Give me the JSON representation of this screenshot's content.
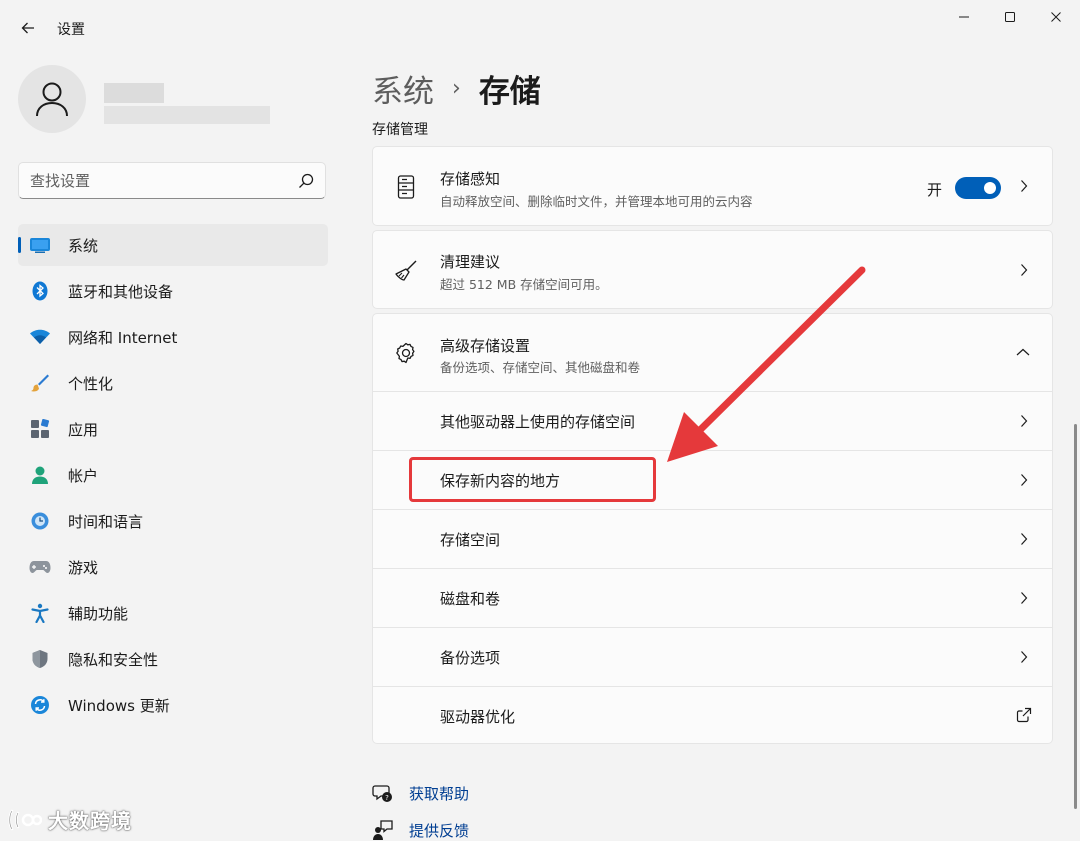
{
  "app": {
    "title": "设置"
  },
  "window_controls": {
    "minimize": "—",
    "maximize": "☐",
    "close": "✕"
  },
  "search": {
    "placeholder": "查找设置"
  },
  "nav": {
    "items": [
      {
        "label": "系统",
        "icon": "system-icon",
        "active": true
      },
      {
        "label": "蓝牙和其他设备",
        "icon": "bluetooth-icon"
      },
      {
        "label": "网络和 Internet",
        "icon": "wifi-icon"
      },
      {
        "label": "个性化",
        "icon": "brush-icon"
      },
      {
        "label": "应用",
        "icon": "apps-icon"
      },
      {
        "label": "帐户",
        "icon": "account-icon"
      },
      {
        "label": "时间和语言",
        "icon": "time-language-icon"
      },
      {
        "label": "游戏",
        "icon": "gamepad-icon"
      },
      {
        "label": "辅助功能",
        "icon": "accessibility-icon"
      },
      {
        "label": "隐私和安全性",
        "icon": "shield-icon"
      },
      {
        "label": "Windows 更新",
        "icon": "windows-update-icon"
      }
    ]
  },
  "header": {
    "parent": "系统",
    "separator": "›",
    "current": "存储"
  },
  "section": {
    "heading": "存储管理"
  },
  "cards": {
    "storage_sense": {
      "title": "存储感知",
      "desc": "自动释放空间、删除临时文件，并管理本地可用的云内容",
      "toggle_label": "开",
      "toggle_on": true
    },
    "cleanup": {
      "title": "清理建议",
      "desc": "超过 512 MB 存储空间可用。"
    },
    "advanced": {
      "title": "高级存储设置",
      "desc": "备份选项、存储空间、其他磁盘和卷",
      "expanded": true,
      "rows": [
        {
          "label": "其他驱动器上使用的存储空间"
        },
        {
          "label": "保存新内容的地方",
          "highlighted": true
        },
        {
          "label": "存储空间"
        },
        {
          "label": "磁盘和卷"
        },
        {
          "label": "备份选项"
        },
        {
          "label": "驱动器优化",
          "external": true
        }
      ]
    }
  },
  "links": {
    "help": "获取帮助",
    "feedback": "提供反馈"
  },
  "watermark": {
    "text": "大数跨境"
  },
  "colors": {
    "accent": "#005fb8",
    "annotation": "#e5393b",
    "link": "#003e92"
  }
}
